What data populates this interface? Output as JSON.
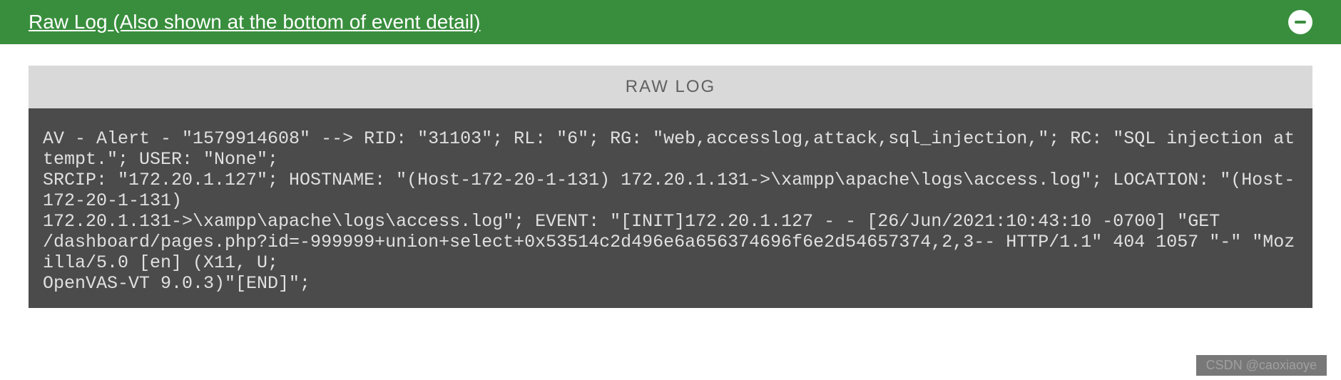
{
  "header": {
    "title": "Raw Log (Also shown at the bottom of event detail)"
  },
  "panel": {
    "label": "RAW LOG",
    "log_text": "AV - Alert - \"1579914608\" --> RID: \"31103\"; RL: \"6\"; RG: \"web,accesslog,attack,sql_injection,\"; RC: \"SQL injection attempt.\"; USER: \"None\";\nSRCIP: \"172.20.1.127\"; HOSTNAME: \"(Host-172-20-1-131) 172.20.1.131->\\xampp\\apache\\logs\\access.log\"; LOCATION: \"(Host-172-20-1-131)\n172.20.1.131->\\xampp\\apache\\logs\\access.log\"; EVENT: \"[INIT]172.20.1.127 - - [26/Jun/2021:10:43:10 -0700] \"GET\n/dashboard/pages.php?id=-999999+union+select+0x53514c2d496e6a656374696f6e2d54657374,2,3-- HTTP/1.1\" 404 1057 \"-\" \"Mozilla/5.0 [en] (X11, U;\nOpenVAS-VT 9.0.3)\"[END]\";"
  },
  "watermark": "CSDN @caoxiaoye"
}
